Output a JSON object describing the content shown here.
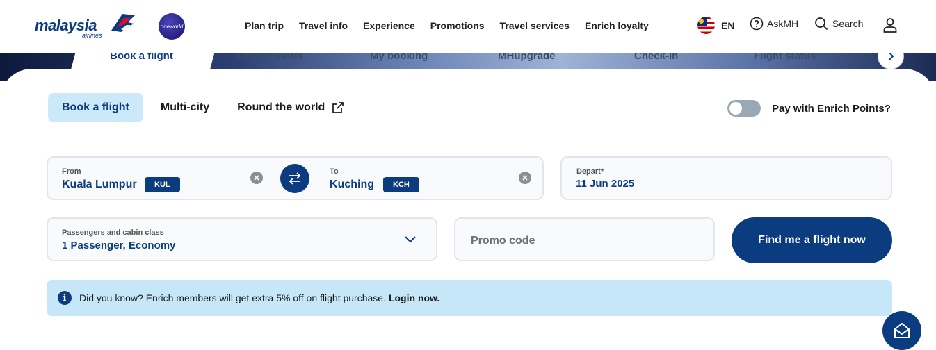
{
  "brand": {
    "logo_text": "malaysia",
    "logo_sub": "airlines",
    "alliance": "oneworld"
  },
  "nav": {
    "items": [
      "Plan trip",
      "Travel info",
      "Experience",
      "Promotions",
      "Travel services",
      "Enrich loyalty"
    ]
  },
  "utilities": {
    "language": "EN",
    "ask": "AskMH",
    "search": "Search"
  },
  "booking_tabs": [
    "Book a flight",
    "Flight + Hotel",
    "My booking",
    "MHupgrade",
    "Check-in",
    "Flight status"
  ],
  "trip_type": {
    "tabs": [
      "Book a flight",
      "Multi-city",
      "Round the world"
    ],
    "active": "Book a flight"
  },
  "enrich_points": {
    "label": "Pay with Enrich Points?",
    "enabled": false
  },
  "from": {
    "label": "From",
    "city": "Kuala Lumpur",
    "code": "KUL"
  },
  "to": {
    "label": "To",
    "city": "Kuching",
    "code": "KCH"
  },
  "depart": {
    "label": "Depart*",
    "date": "11 Jun 2025"
  },
  "passengers": {
    "label": "Passengers and cabin class",
    "value": "1 Passenger, Economy"
  },
  "promo": {
    "placeholder": "Promo code"
  },
  "search_button": "Find me a flight now",
  "info_banner": {
    "text": "Did you know? Enrich members will get extra 5% off on flight purchase.",
    "link": "Login now.",
    "icon": "i"
  },
  "colors": {
    "primary": "#0c3c80",
    "tab_active_bg": "#cbe9f8",
    "banner_bg": "#c6e7f7"
  }
}
